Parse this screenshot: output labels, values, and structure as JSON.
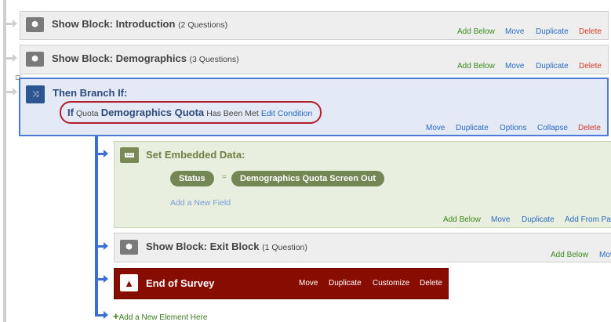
{
  "blocks": [
    {
      "title": "Show Block: Introduction",
      "count": "(2 Questions)",
      "actions": [
        "Add Below",
        "Move",
        "Duplicate",
        "Delete"
      ]
    },
    {
      "title": "Show Block: Demographics",
      "count": "(3 Questions)",
      "actions": [
        "Add Below",
        "Move",
        "Duplicate",
        "Delete"
      ]
    }
  ],
  "branch": {
    "title": "Then Branch If:",
    "cond_if": "If",
    "cond_type": "Quota",
    "cond_name": "Demographics Quota",
    "cond_state": "Has Been Met",
    "edit": "Edit Condition",
    "actions": [
      "Move",
      "Duplicate",
      "Options",
      "Collapse",
      "Delete"
    ]
  },
  "embedded": {
    "icon_text": "ED",
    "title": "Set Embedded Data:",
    "field": "Status",
    "eq": "=",
    "value": "Demographics Quota Screen Out",
    "add_field": "Add a New Field",
    "actions": [
      "Add Below",
      "Move",
      "Duplicate",
      "Add From Pa"
    ]
  },
  "exit_block": {
    "title": "Show Block: Exit Block",
    "count": "(1 Question)",
    "actions": [
      "Add Below",
      "Mov"
    ]
  },
  "end": {
    "title": "End of Survey",
    "actions": [
      "Move",
      "Duplicate",
      "Customize",
      "Delete"
    ]
  },
  "add_element": "Add a New Element Here"
}
